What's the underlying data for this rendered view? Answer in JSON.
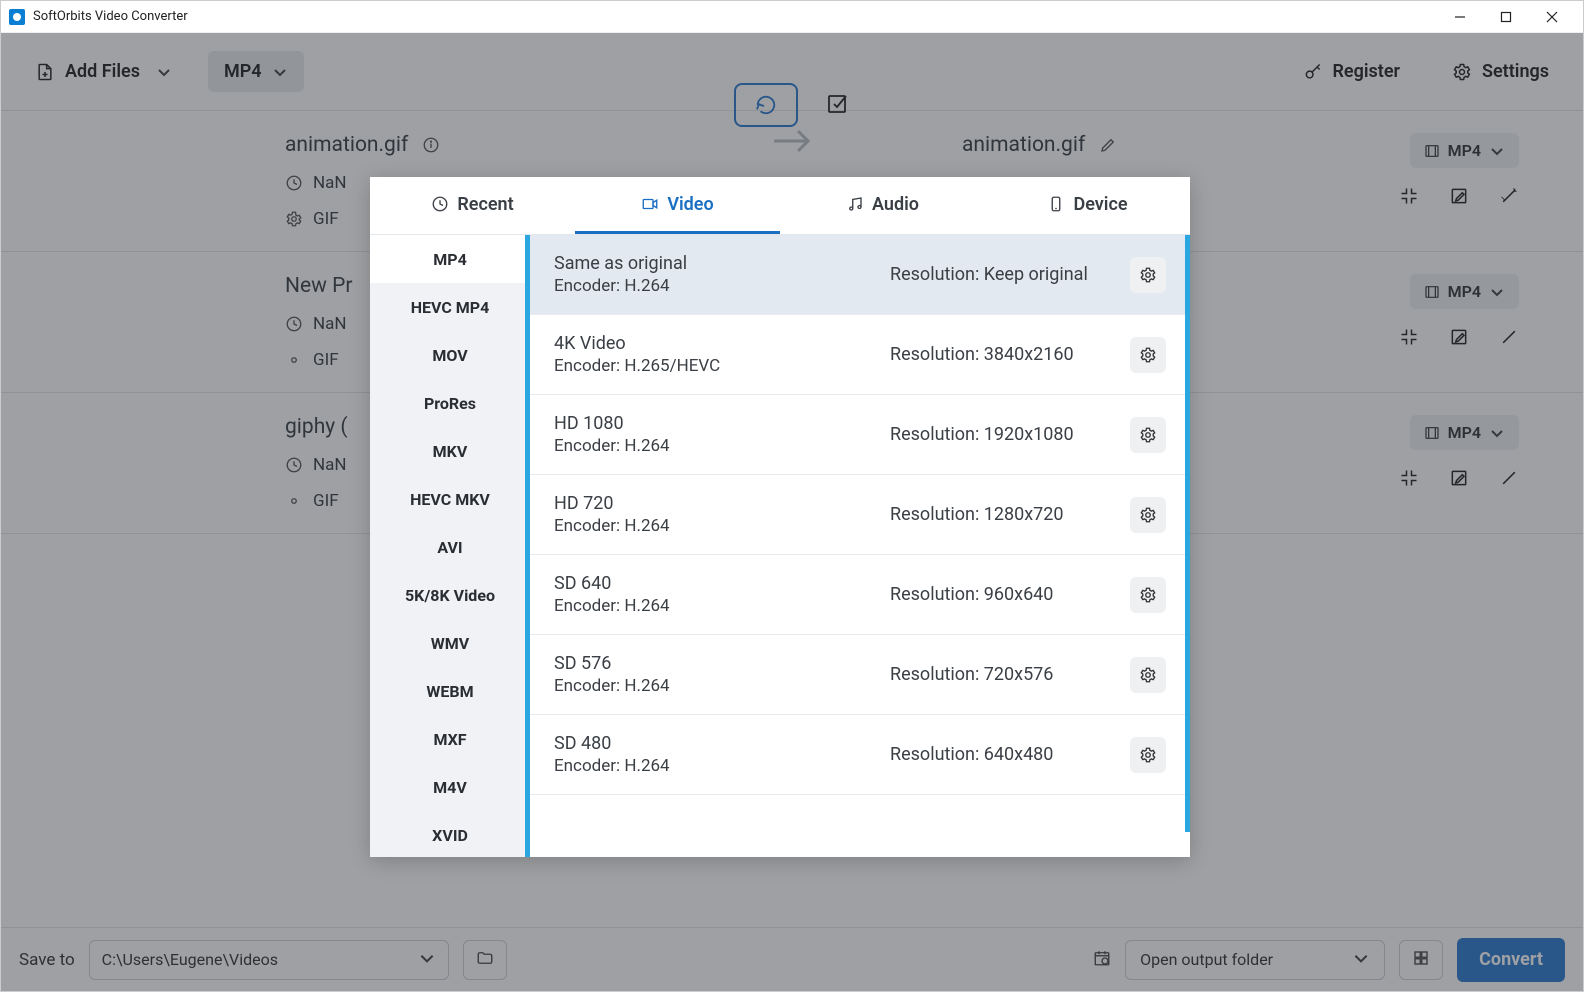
{
  "window": {
    "title": "SoftOrbits Video Converter"
  },
  "toolbar": {
    "add_files": "Add Files",
    "format": "MP4",
    "register": "Register",
    "settings": "Settings"
  },
  "files": [
    {
      "src_name": "animation.gif",
      "dst_name": "animation.gif",
      "time": "NaN",
      "codec": "GIF",
      "dst_format": "MP4"
    },
    {
      "src_name": "New Pr",
      "dst_name": "",
      "time": "NaN",
      "codec": "GIF",
      "dst_format": "MP4"
    },
    {
      "src_name": "giphy (",
      "dst_name": "",
      "time": "NaN",
      "codec": "GIF",
      "dst_format": "MP4"
    }
  ],
  "footer": {
    "save_to_label": "Save to",
    "path": "C:\\Users\\Eugene\\Videos",
    "open_output": "Open output folder",
    "convert": "Convert"
  },
  "popup": {
    "tabs": {
      "recent": "Recent",
      "video": "Video",
      "audio": "Audio",
      "device": "Device"
    },
    "formats": [
      "MP4",
      "HEVC MP4",
      "MOV",
      "ProRes",
      "MKV",
      "HEVC MKV",
      "AVI",
      "5K/8K Video",
      "WMV",
      "WEBM",
      "MXF",
      "M4V",
      "XVID"
    ],
    "presets": [
      {
        "title": "Same as original",
        "encoder": "Encoder: H.264",
        "res": "Resolution: Keep original",
        "selected": true
      },
      {
        "title": "4K Video",
        "encoder": "Encoder: H.265/HEVC",
        "res": "Resolution: 3840x2160"
      },
      {
        "title": "HD 1080",
        "encoder": "Encoder: H.264",
        "res": "Resolution: 1920x1080"
      },
      {
        "title": "HD 720",
        "encoder": "Encoder: H.264",
        "res": "Resolution: 1280x720"
      },
      {
        "title": "SD 640",
        "encoder": "Encoder: H.264",
        "res": "Resolution: 960x640"
      },
      {
        "title": "SD 576",
        "encoder": "Encoder: H.264",
        "res": "Resolution: 720x576"
      },
      {
        "title": "SD 480",
        "encoder": "Encoder: H.264",
        "res": "Resolution: 640x480"
      }
    ]
  }
}
